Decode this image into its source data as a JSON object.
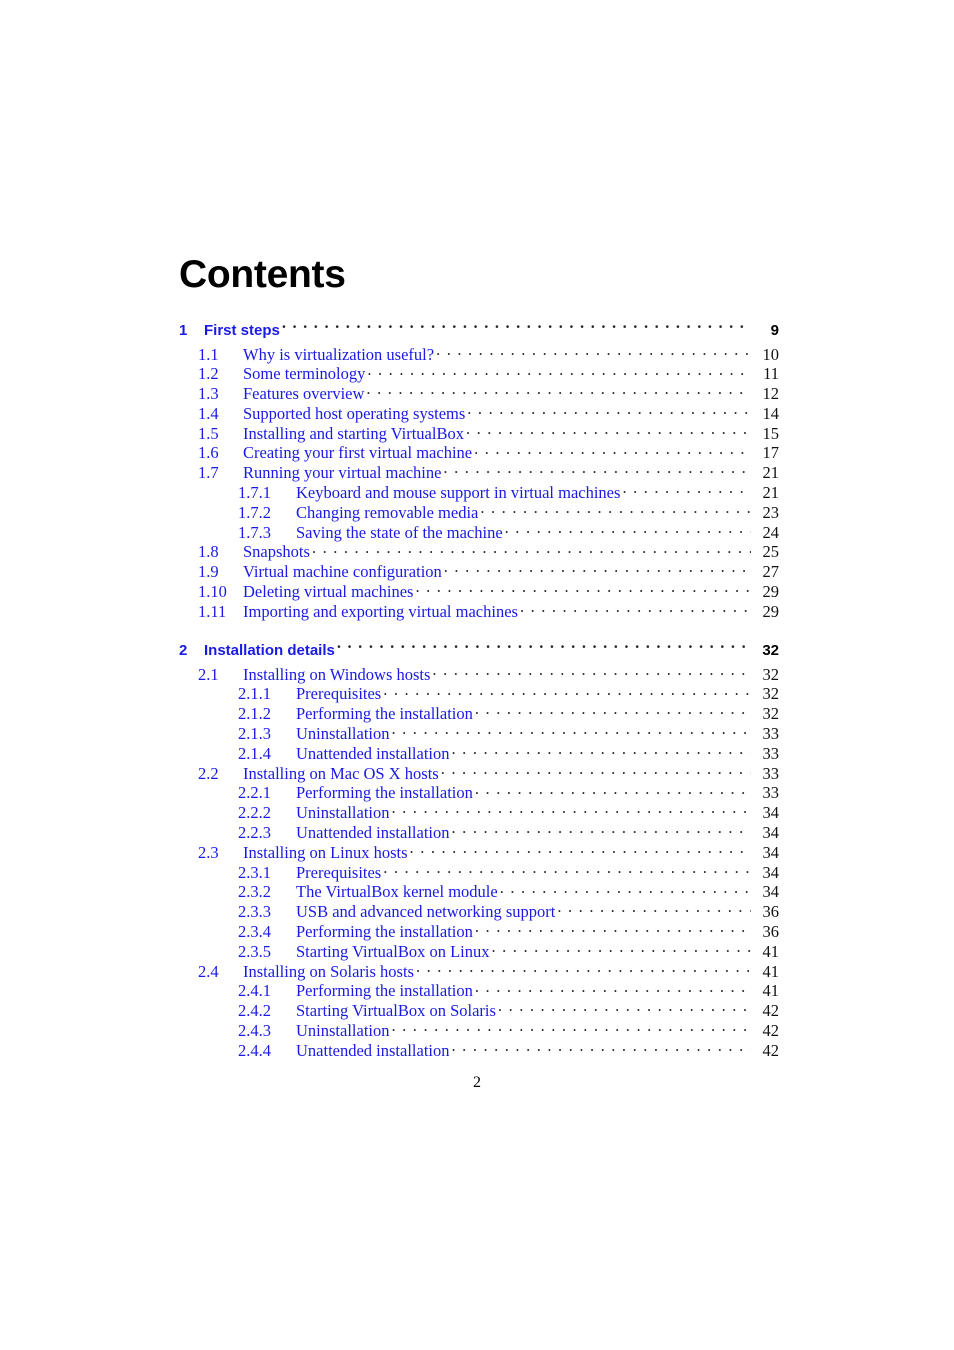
{
  "document": {
    "title": "Contents",
    "folio": "2"
  },
  "colors": {
    "link_blue": "#1a1ae6",
    "text_black": "#000000",
    "leader_dots": "#2a2a2a",
    "page_background": "#ffffff"
  },
  "toc": {
    "entries": [
      {
        "level": 0,
        "number": "1",
        "title": "First steps",
        "page": "9"
      },
      {
        "level": 1,
        "number": "1.1",
        "title": "Why is virtualization useful?",
        "page": "10"
      },
      {
        "level": 1,
        "number": "1.2",
        "title": "Some terminology",
        "page": "11"
      },
      {
        "level": 1,
        "number": "1.3",
        "title": "Features overview",
        "page": "12"
      },
      {
        "level": 1,
        "number": "1.4",
        "title": "Supported host operating systems",
        "page": "14"
      },
      {
        "level": 1,
        "number": "1.5",
        "title": "Installing and starting VirtualBox",
        "page": "15"
      },
      {
        "level": 1,
        "number": "1.6",
        "title": "Creating your first virtual machine",
        "page": "17"
      },
      {
        "level": 1,
        "number": "1.7",
        "title": "Running your virtual machine",
        "page": "21"
      },
      {
        "level": 2,
        "number": "1.7.1",
        "title": "Keyboard and mouse support in virtual machines",
        "page": "21"
      },
      {
        "level": 2,
        "number": "1.7.2",
        "title": "Changing removable media",
        "page": "23"
      },
      {
        "level": 2,
        "number": "1.7.3",
        "title": "Saving the state of the machine",
        "page": "24"
      },
      {
        "level": 1,
        "number": "1.8",
        "title": "Snapshots",
        "page": "25"
      },
      {
        "level": 1,
        "number": "1.9",
        "title": "Virtual machine configuration",
        "page": "27"
      },
      {
        "level": 1,
        "number": "1.10",
        "title": "Deleting virtual machines",
        "page": "29"
      },
      {
        "level": 1,
        "number": "1.11",
        "title": "Importing and exporting virtual machines",
        "page": "29"
      },
      {
        "level": 0,
        "number": "2",
        "title": "Installation details",
        "page": "32",
        "gap_before": true
      },
      {
        "level": 1,
        "number": "2.1",
        "title": "Installing on Windows hosts",
        "page": "32"
      },
      {
        "level": 2,
        "number": "2.1.1",
        "title": "Prerequisites",
        "page": "32"
      },
      {
        "level": 2,
        "number": "2.1.2",
        "title": "Performing the installation",
        "page": "32"
      },
      {
        "level": 2,
        "number": "2.1.3",
        "title": "Uninstallation",
        "page": "33"
      },
      {
        "level": 2,
        "number": "2.1.4",
        "title": "Unattended installation",
        "page": "33"
      },
      {
        "level": 1,
        "number": "2.2",
        "title": "Installing on Mac OS X hosts",
        "page": "33"
      },
      {
        "level": 2,
        "number": "2.2.1",
        "title": "Performing the installation",
        "page": "33"
      },
      {
        "level": 2,
        "number": "2.2.2",
        "title": "Uninstallation",
        "page": "34"
      },
      {
        "level": 2,
        "number": "2.2.3",
        "title": "Unattended installation",
        "page": "34"
      },
      {
        "level": 1,
        "number": "2.3",
        "title": "Installing on Linux hosts",
        "page": "34"
      },
      {
        "level": 2,
        "number": "2.3.1",
        "title": "Prerequisites",
        "page": "34"
      },
      {
        "level": 2,
        "number": "2.3.2",
        "title": "The VirtualBox kernel module",
        "page": "34"
      },
      {
        "level": 2,
        "number": "2.3.3",
        "title": "USB and advanced networking support",
        "page": "36"
      },
      {
        "level": 2,
        "number": "2.3.4",
        "title": "Performing the installation",
        "page": "36"
      },
      {
        "level": 2,
        "number": "2.3.5",
        "title": "Starting VirtualBox on Linux",
        "page": "41"
      },
      {
        "level": 1,
        "number": "2.4",
        "title": "Installing on Solaris hosts",
        "page": "41"
      },
      {
        "level": 2,
        "number": "2.4.1",
        "title": "Performing the installation",
        "page": "41"
      },
      {
        "level": 2,
        "number": "2.4.2",
        "title": "Starting VirtualBox on Solaris",
        "page": "42"
      },
      {
        "level": 2,
        "number": "2.4.3",
        "title": "Uninstallation",
        "page": "42"
      },
      {
        "level": 2,
        "number": "2.4.4",
        "title": "Unattended installation",
        "page": "42"
      }
    ]
  }
}
